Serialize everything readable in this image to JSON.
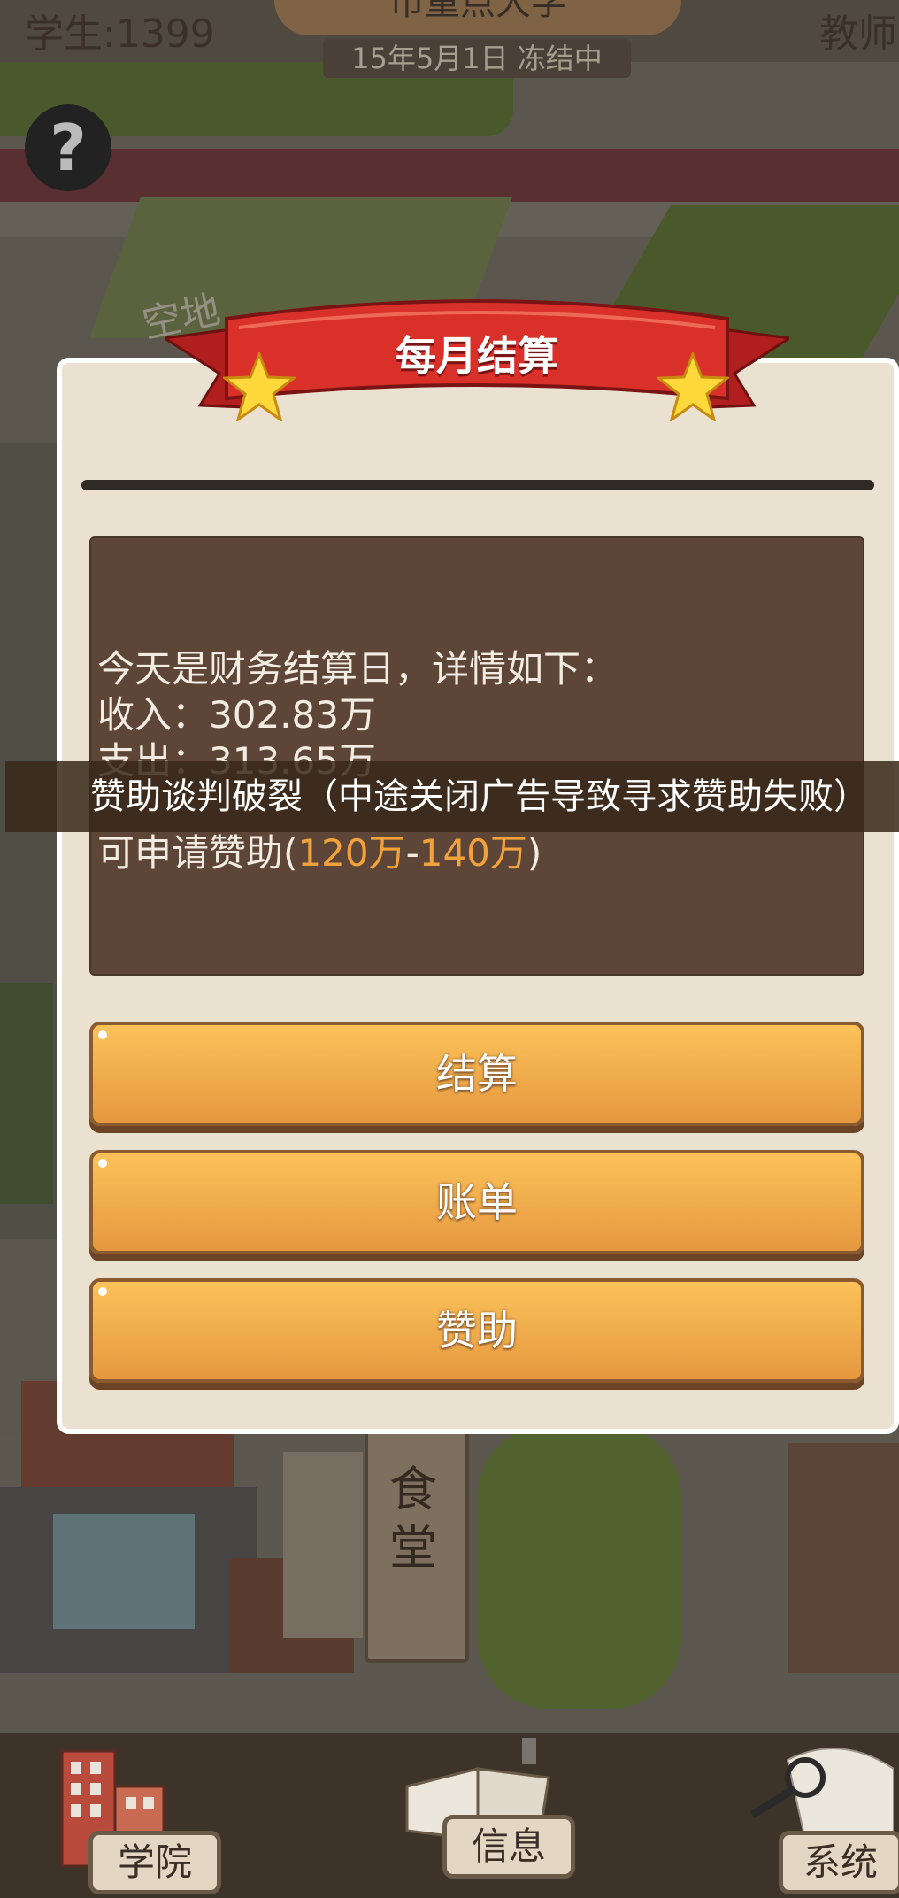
{
  "hud": {
    "students": "学生:1399",
    "teachers": "教师",
    "school_name": "市重点大学",
    "date_status": "15年5月1日 冻结中",
    "help_label": "?"
  },
  "map": {
    "empty_lot_label": "空地",
    "canteen_label": "食堂"
  },
  "dialog": {
    "title": "每月结算",
    "lines": [
      "今天是财务结算日，详情如下：",
      "收入：302.83万",
      "支出：313.65万"
    ],
    "sponsor_prefix": "可申请赞助(",
    "sponsor_low": "120万",
    "sponsor_dash": "-",
    "sponsor_high": "140万",
    "sponsor_suffix": ")",
    "buttons": {
      "settle": "结算",
      "bill": "账单",
      "sponsor": "赞助"
    }
  },
  "toast": "赞助谈判破裂（中途关闭广告导致寻求赞助失败）",
  "bottom_nav": {
    "college": "学院",
    "info": "信息",
    "system": "系统"
  },
  "colors": {
    "button_top": "#fbc25a",
    "button_bottom": "#e5983f",
    "ribbon_red": "#d9302a",
    "info_box": "#5d4637",
    "highlight": "#f2a23a"
  }
}
